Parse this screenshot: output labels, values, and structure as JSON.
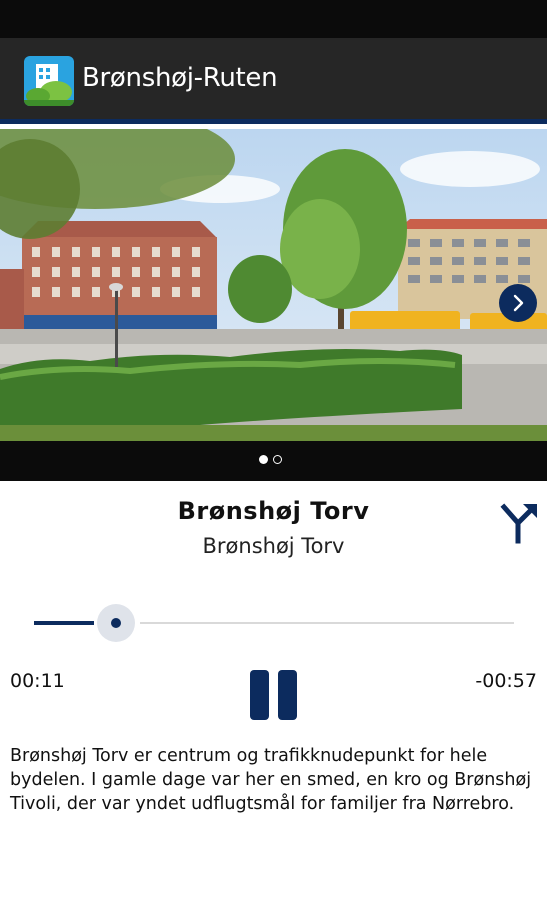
{
  "app": {
    "title": "Brønshøj-Ruten",
    "icon": "app-logo-icon"
  },
  "gallery": {
    "current_page": 1,
    "total_pages": 2,
    "next_icon": "chevron-right-icon"
  },
  "stop": {
    "title": "Brønshøj Torv",
    "subtitle": "Brønshøj Torv",
    "route_icon": "directions-fork-icon"
  },
  "player": {
    "elapsed": "00:11",
    "remaining": "-00:57",
    "progress": 0.16,
    "state_icon": "pause-icon"
  },
  "description": "Brønshøj Torv er centrum og trafikknudepunkt for hele bydelen. I gamle dage var her en smed, en kro og Brønshøj Tivoli, der var yndet udflugtsmål for familjer fra Nørrebro.",
  "colors": {
    "accent": "#0c2b5e",
    "action_bar": "#262626",
    "status_bar": "#0b0b0b"
  }
}
